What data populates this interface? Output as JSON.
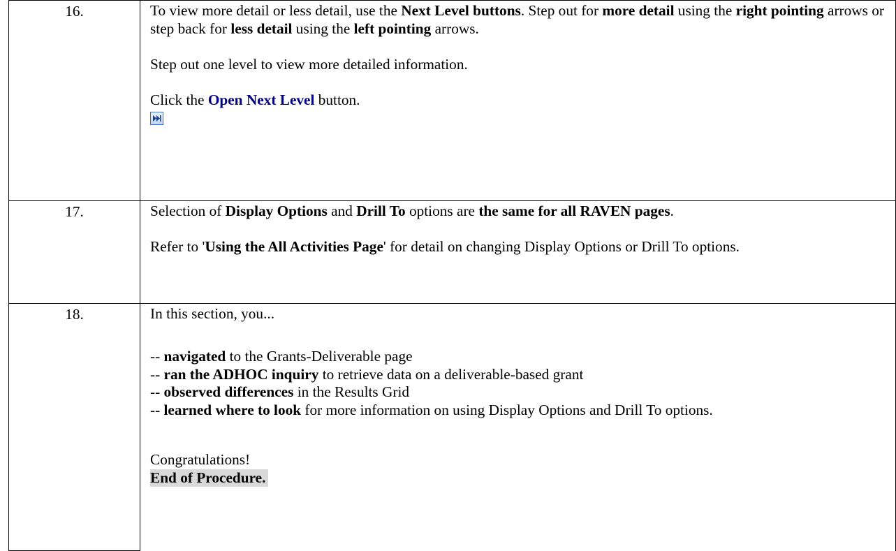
{
  "steps": [
    {
      "number": "16.",
      "p1": {
        "t1": "To view more detail or less detail, use the ",
        "b1": "Next Level buttons",
        "t2": ".  Step out for ",
        "b2": "more detail",
        "t3": " using the ",
        "b3": "right pointing",
        "t4": " arrows or step back for ",
        "b4": "less detail",
        "t5": " using the ",
        "b5": "left pointing",
        "t6": " arrows."
      },
      "p2": "Step out one level to view more detailed information.",
      "p3": {
        "t1": "Click the ",
        "link": "Open Next Level",
        "t2": " button."
      },
      "icon": "open-next-level-icon"
    },
    {
      "number": "17.",
      "p1": {
        "t1": "Selection of ",
        "b1": "Display Options",
        "t2": " and ",
        "b2": "Drill To",
        "t3": " options are ",
        "b3": "the same for all RAVEN pages",
        "t4": "."
      },
      "p2": {
        "t1": "Refer to '",
        "b1": "Using the All Activities Page",
        "t2": "' for detail on changing Display Options or Drill To options."
      }
    },
    {
      "number": "18.",
      "intro": "In this section, you...",
      "bullets": [
        {
          "prefix": "-- ",
          "bold": "navigated",
          "rest": " to the Grants-Deliverable page"
        },
        {
          "prefix": "-- ",
          "bold": "ran the ADHOC inquiry",
          "rest": " to retrieve data on a deliverable-based grant"
        },
        {
          "prefix": "-- ",
          "bold": "observed differences",
          "rest": " in the Results Grid"
        },
        {
          "prefix": "-- ",
          "bold": "learned where to look",
          "rest": " for more information on using Display Options and Drill To options."
        }
      ],
      "congrats": "Congratulations!",
      "end": "End of Procedure."
    }
  ]
}
